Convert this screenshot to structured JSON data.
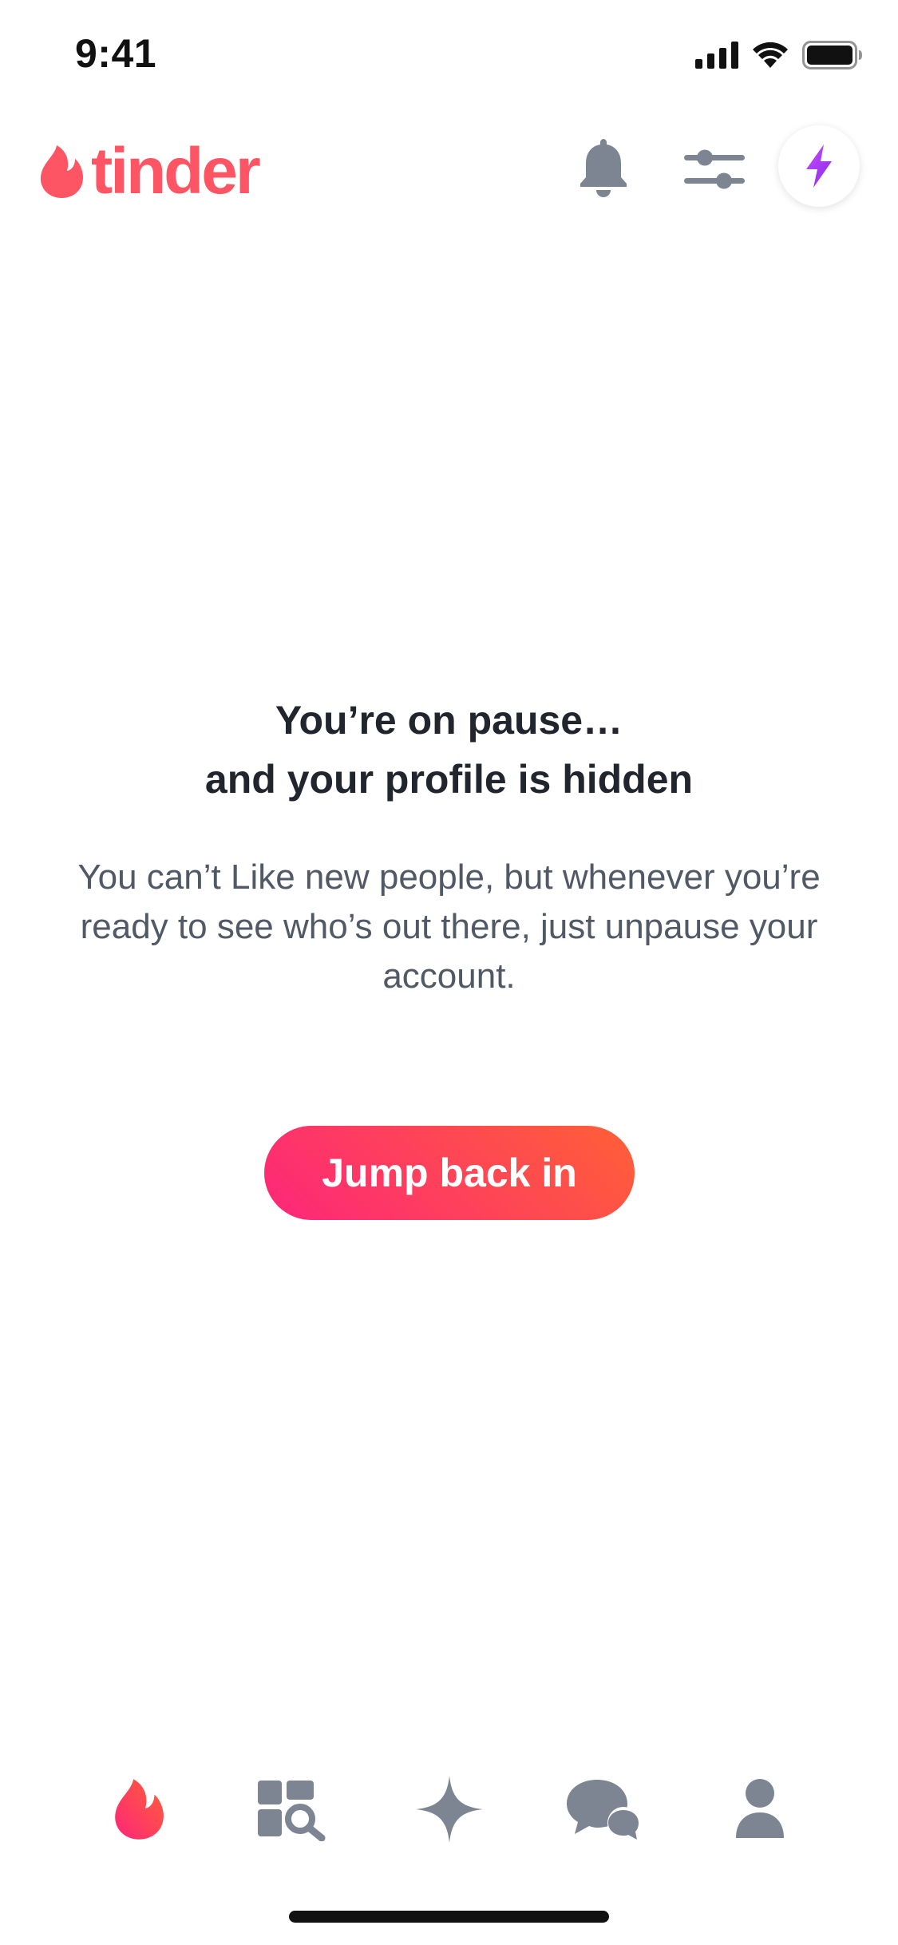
{
  "status_bar": {
    "time": "9:41"
  },
  "header": {
    "logo_text": "tinder",
    "icons": [
      "flame-icon",
      "bell-icon",
      "sliders-icon",
      "lightning-icon"
    ]
  },
  "message": {
    "title_line1": "You’re on pause…",
    "title_line2": "and your profile is hidden",
    "description": "You can’t Like new people, but whenever you’re ready to see who’s out there, just unpause your account."
  },
  "actions": {
    "jump_back_label": "Jump back in"
  },
  "bottom_nav": {
    "items": [
      {
        "icon": "flame-icon",
        "active": true
      },
      {
        "icon": "explore-icon",
        "active": false
      },
      {
        "icon": "sparkle-icon",
        "active": false
      },
      {
        "icon": "chat-icon",
        "active": false
      },
      {
        "icon": "profile-icon",
        "active": false
      }
    ]
  },
  "colors": {
    "brand": "#fd5564",
    "gradient_start": "#fd267a",
    "gradient_end": "#ff6036",
    "boost_purple": "#a335ee",
    "icon_gray": "#7c8591",
    "title_text": "#21262e",
    "body_text": "#505965"
  }
}
